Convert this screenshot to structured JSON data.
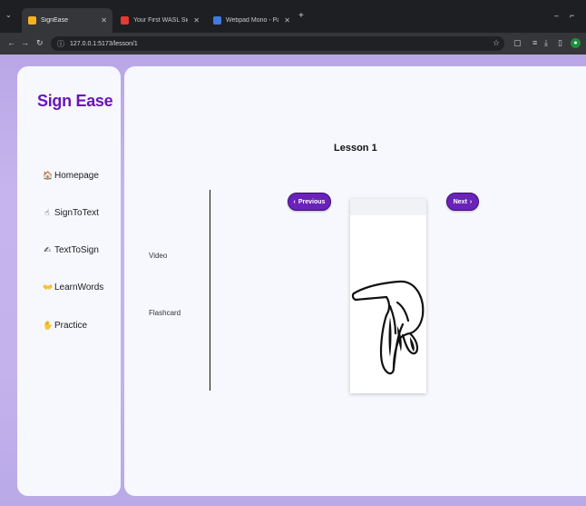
{
  "browser": {
    "tabs": [
      {
        "title": "SignEase",
        "active": true,
        "favicon_color": "#f6b21a"
      },
      {
        "title": "Your First WASL Sign (Intro)",
        "active": false,
        "favicon_color": "#e53935"
      },
      {
        "title": "Webpad Mono - Paginated",
        "active": false,
        "favicon_color": "#3f7be0"
      }
    ],
    "tab_dropdown": "⌄",
    "new_tab": "+",
    "address": "127.0.0.1:5173/lesson/1",
    "window_controls": [
      "–",
      "⌐"
    ]
  },
  "sidebar": {
    "brand": "Sign Ease",
    "items": [
      {
        "label": "Homepage",
        "icon": "home-icon",
        "glyph": "🏠"
      },
      {
        "label": "SignToText",
        "icon": "hand-pointing-icon",
        "glyph": "☝"
      },
      {
        "label": "TextToSign",
        "icon": "text-sign-icon",
        "glyph": "✍"
      },
      {
        "label": "LearnWords",
        "icon": "learn-words-icon",
        "glyph": "👐"
      },
      {
        "label": "Practice",
        "icon": "practice-icon",
        "glyph": "✋"
      }
    ]
  },
  "lesson": {
    "title": "Lesson 1",
    "options": [
      "Video",
      "Flashcard"
    ],
    "prev_label": "Previous",
    "next_label": "Next",
    "prev_glyph": "‹",
    "next_glyph": "›"
  },
  "colors": {
    "brand": "#6a16b5",
    "button": "#6a22b8",
    "background_gradient": "#c4b2ec",
    "panel": "#f6f8fe"
  }
}
